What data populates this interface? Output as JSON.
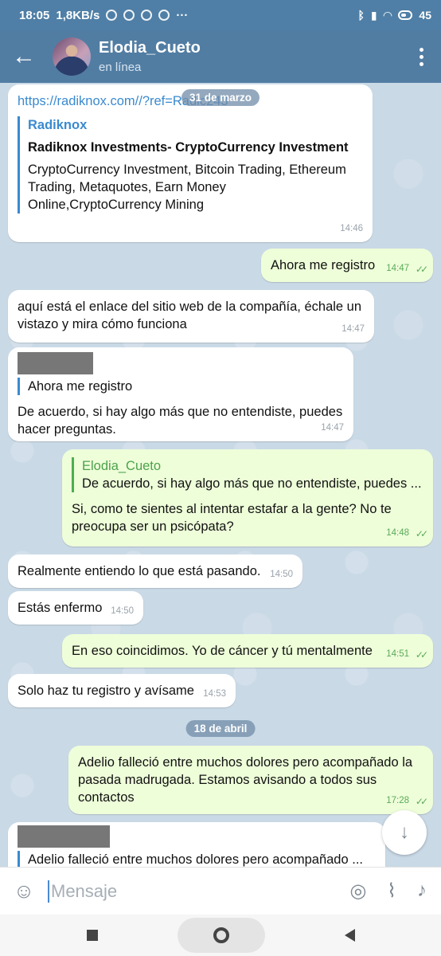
{
  "status": {
    "time": "18:05",
    "speed": "1,8KB/s",
    "battery": "45"
  },
  "header": {
    "contact_name": "Elodia_Cueto",
    "status": "en línea"
  },
  "dates": [
    "31 de marzo",
    "18 de abril"
  ],
  "messages": {
    "m1": {
      "link": "https://radiknox.com//?ref=Radic243",
      "site": "Radiknox",
      "title": "Radiknox Investments- CryptoCurrency Investment",
      "description": "CryptoCurrency Investment, Bitcoin Trading, Ethereum Trading, Metaquotes, Earn Money Online,CryptoCurrency Mining",
      "time": "14:46"
    },
    "m2": {
      "text": "Ahora me registro",
      "time": "14:47"
    },
    "m3": {
      "text": "aquí está el enlace del sitio web de la compañía, échale un vistazo y mira cómo funciona",
      "time": "14:47"
    },
    "m4": {
      "quote": "Ahora me registro",
      "text": "De acuerdo, si hay algo más que no entendiste, puedes hacer preguntas.",
      "time": "14:47"
    },
    "m5": {
      "quote_name": "Elodia_Cueto",
      "quote": "De acuerdo, si hay algo más que no entendiste, puedes ...",
      "text": "Si, como te sientes al intentar estafar a la gente? No te preocupa ser un psicópata?",
      "time": "14:48"
    },
    "m6": {
      "text": "Realmente entiendo lo que está pasando.",
      "time": "14:50"
    },
    "m7": {
      "text": "Estás enfermo",
      "time": "14:50"
    },
    "m8": {
      "text": "En eso coincidimos. Yo de cáncer y tú mentalmente",
      "time": "14:51"
    },
    "m9": {
      "text": "Solo haz tu registro y avísame",
      "time": "14:53"
    },
    "m10": {
      "text": "Adelio falleció entre muchos dolores pero acompañado la pasada madrugada. Estamos avisando a todos sus contactos",
      "time": "17:28"
    },
    "m11": {
      "quote": "Adelio falleció entre muchos dolores pero acompañado ..."
    }
  },
  "input": {
    "placeholder": "Mensaje"
  },
  "icons": {
    "back": "arrow-back-icon",
    "menu": "more-vert-icon",
    "emoji": "emoji-icon",
    "camera": "camera-icon",
    "attach": "paperclip-icon",
    "mic": "microphone-icon",
    "scroll": "chevron-down-icon"
  },
  "colors": {
    "header": "#527da3",
    "outgoing_bubble": "#eefed9",
    "incoming_bubble": "#ffffff",
    "link": "#3a8ad0",
    "read_ticks": "#5aaa5a"
  }
}
